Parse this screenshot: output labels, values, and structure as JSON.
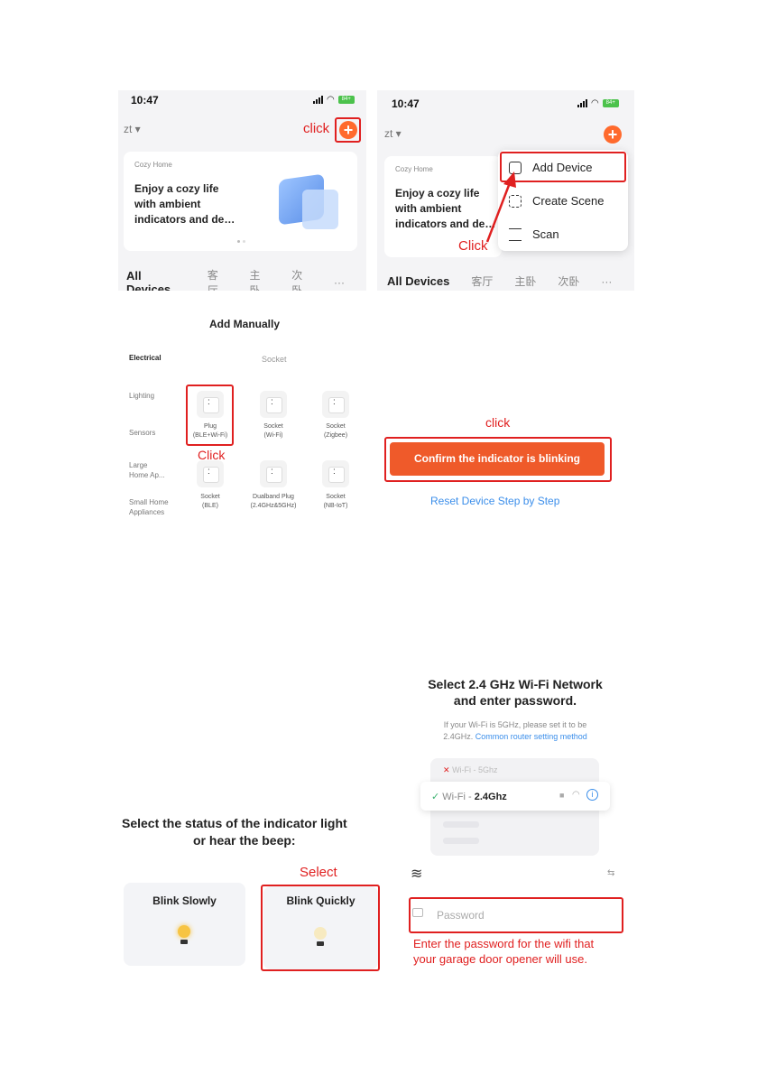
{
  "step1": {
    "left": {
      "time": "10:47",
      "battery": "84+",
      "home_name": "zt ▾",
      "click_label": "click",
      "plus": "+",
      "card_small": "Cozy Home",
      "card_line1": "Enjoy a cozy life",
      "card_line2": "with ambient",
      "card_line3": "indicators and de…",
      "tabs": [
        "All Devices",
        "客厅",
        "主卧",
        "次卧",
        "···"
      ]
    },
    "right": {
      "time": "10:47",
      "battery": "84+",
      "home_name": "zt ▾",
      "plus": "+",
      "card_small": "Cozy Home",
      "card_line1": "Enjoy a cozy life",
      "card_line2": "with ambient",
      "card_line3": "indicators and de…",
      "menu": [
        "Add Device",
        "Create Scene",
        "Scan"
      ],
      "click_label": "Click",
      "tabs": [
        "All Devices",
        "客厅",
        "主卧",
        "次卧",
        "···"
      ]
    }
  },
  "step2": {
    "title": "Add Manually",
    "section": "Socket",
    "categories": [
      "Electrical",
      "Lighting",
      "Sensors",
      "Large\nHome Ap...",
      "Small Home\nAppliances"
    ],
    "devices": [
      {
        "name": "Plug",
        "sub": "(BLE+Wi-Fi)"
      },
      {
        "name": "Socket",
        "sub": "(Wi-Fi)"
      },
      {
        "name": "Socket",
        "sub": "(Zigbee)"
      },
      {
        "name": "Socket",
        "sub": "(BLE)"
      },
      {
        "name": "Dualband Plug",
        "sub": "(2.4GHz&5GHz)"
      },
      {
        "name": "Socket",
        "sub": "(NB-IoT)"
      }
    ],
    "click_label": "Click"
  },
  "step3": {
    "click_label": "click",
    "confirm_button": "Confirm the indicator is blinking",
    "reset_link": "Reset Device Step by Step"
  },
  "step4": {
    "title_line1": "Select the status of the indicator light",
    "title_line2": "or hear the beep:",
    "select_label": "Select",
    "option_slow": "Blink Slowly",
    "option_quick": "Blink Quickly"
  },
  "step5": {
    "title_line1": "Select 2.4 GHz Wi-Fi Network",
    "title_line2": "and enter password.",
    "sub_line1": "If your Wi-Fi is 5GHz, please set it to be",
    "sub_line2_a": "2.4GHz.",
    "sub_line2_link": "Common router setting method",
    "wifi_5g": "Wi-Fi - 5Ghz",
    "wifi_24_prefix": "Wi-Fi - ",
    "wifi_24_bold": "2.4Ghz",
    "password_placeholder": "Password",
    "note_line1": "Enter the password for the wifi that",
    "note_line2": "your garage door opener will use."
  },
  "colors": {
    "accent_orange": "#ef5a2a",
    "annotation_red": "#e02020",
    "link_blue": "#3b8eea"
  }
}
